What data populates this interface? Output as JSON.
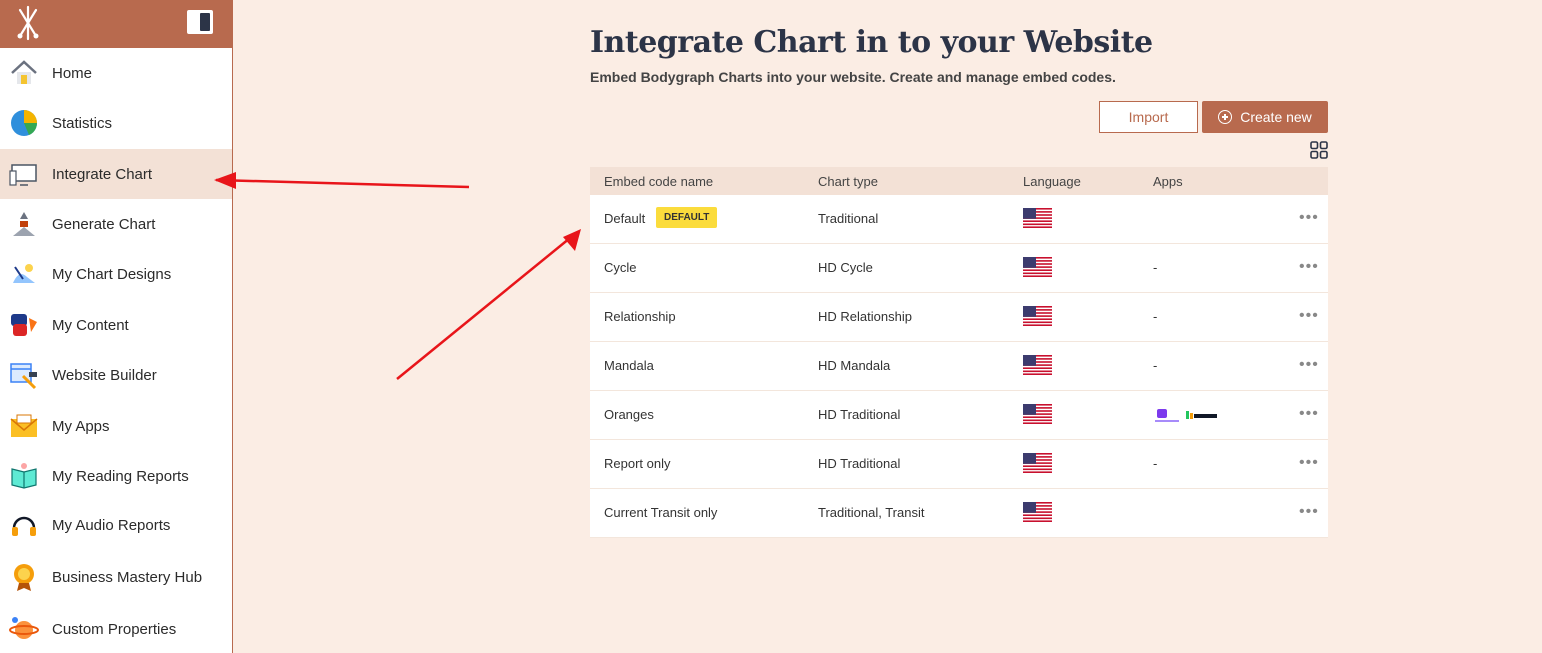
{
  "sidebar": {
    "items": [
      {
        "label": "Home",
        "icon": "home-icon"
      },
      {
        "label": "Statistics",
        "icon": "pie-chart-icon"
      },
      {
        "label": "Integrate Chart",
        "icon": "monitor-icon",
        "active": true
      },
      {
        "label": "Generate Chart",
        "icon": "bodygraph-icon"
      },
      {
        "label": "My Chart Designs",
        "icon": "design-icon"
      },
      {
        "label": "My Content",
        "icon": "content-icon"
      },
      {
        "label": "Website Builder",
        "icon": "website-builder-icon"
      },
      {
        "label": "My Apps",
        "icon": "envelope-icon"
      },
      {
        "label": "My Reading Reports",
        "icon": "book-icon"
      },
      {
        "label": "My Audio Reports",
        "icon": "headphones-icon"
      },
      {
        "label": "Business Mastery Hub",
        "icon": "medal-icon"
      },
      {
        "label": "Custom Properties",
        "icon": "planet-icon"
      }
    ]
  },
  "main": {
    "title": "Integrate Chart in to your Website",
    "subtitle": "Embed Bodygraph Charts into your website. Create and manage embed codes.",
    "import_label": "Import",
    "create_label": "Create new",
    "table": {
      "headers": [
        "Embed code name",
        "Chart type",
        "Language",
        "Apps"
      ],
      "rows": [
        {
          "name": "Default",
          "badge": "DEFAULT",
          "type": "Traditional",
          "language": "us-flag",
          "apps": ""
        },
        {
          "name": "Cycle",
          "type": "HD Cycle",
          "language": "us-flag",
          "apps": "-"
        },
        {
          "name": "Relationship",
          "type": "HD Relationship",
          "language": "us-flag",
          "apps": "-"
        },
        {
          "name": "Mandala",
          "type": "HD Mandala",
          "language": "us-flag",
          "apps": "-"
        },
        {
          "name": "Oranges",
          "type": "HD Traditional",
          "language": "us-flag",
          "apps": "app-logos"
        },
        {
          "name": "Report only",
          "type": "HD Traditional",
          "language": "us-flag",
          "apps": "-"
        },
        {
          "name": "Current Transit only",
          "type": "Traditional, Transit",
          "language": "us-flag",
          "apps": ""
        }
      ]
    }
  },
  "colors": {
    "brand": "#b86a4e",
    "background": "#fbede4",
    "badge": "#fbdc3c",
    "arrow": "#e8151a"
  }
}
